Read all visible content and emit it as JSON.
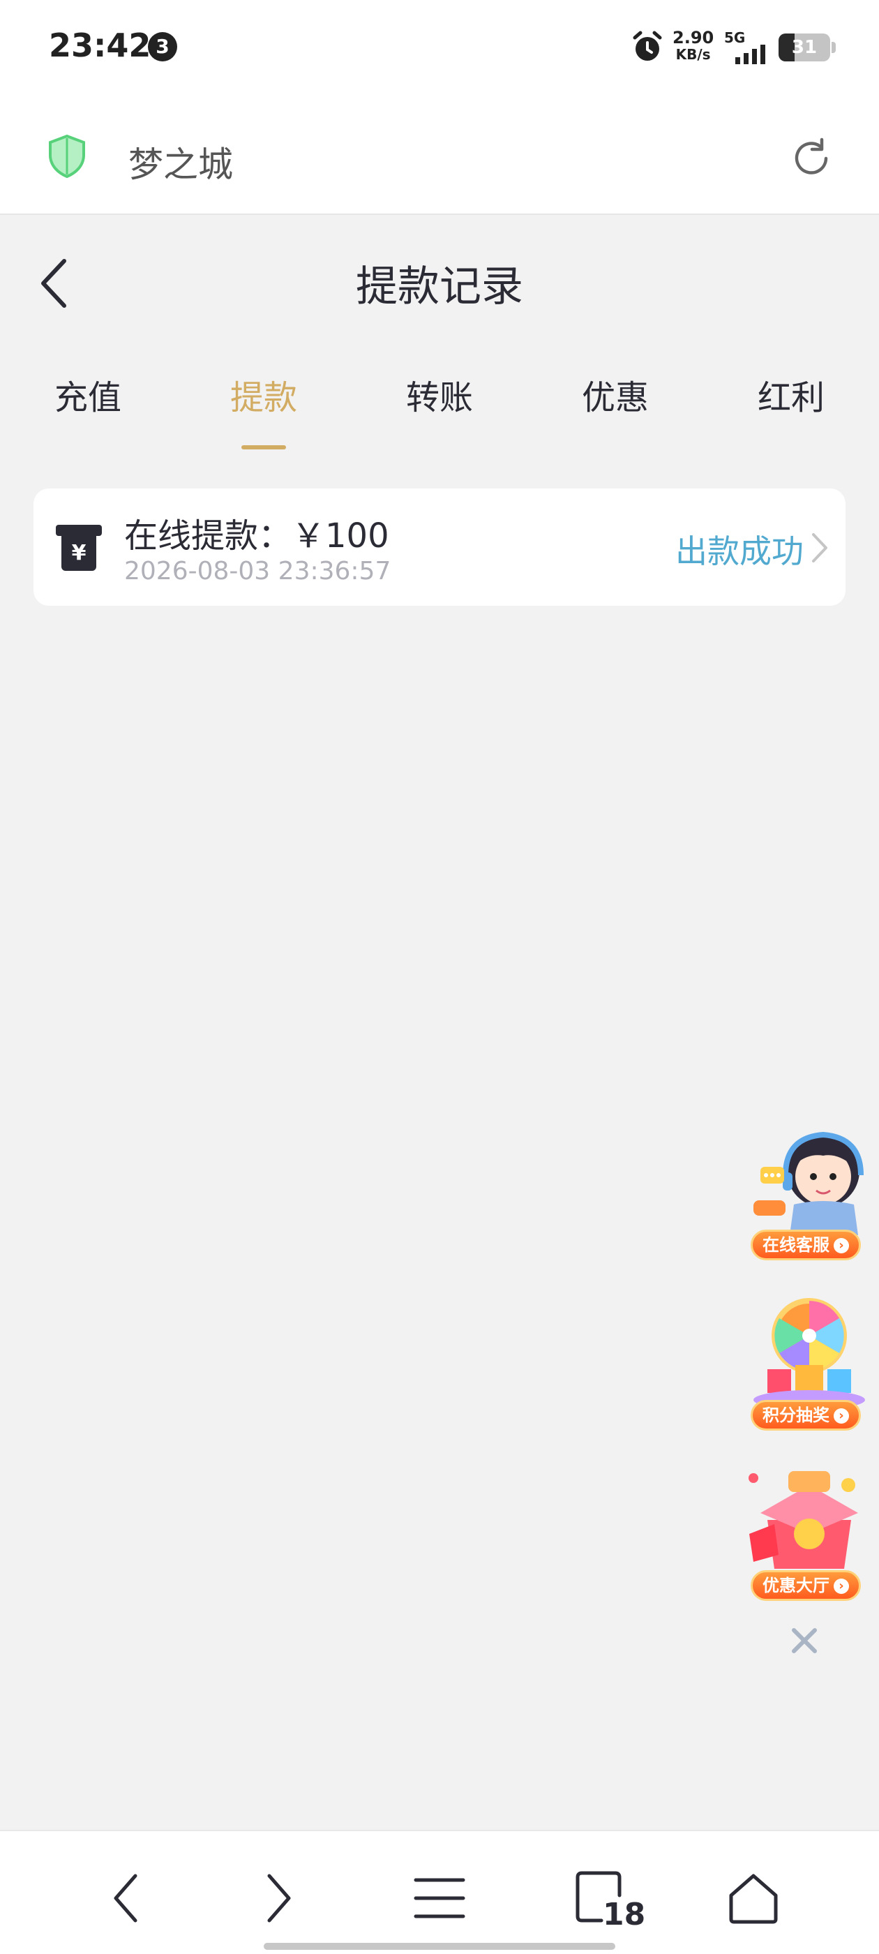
{
  "status_bar": {
    "time": "23:42",
    "notification_count": "3",
    "speed_value": "2.90",
    "speed_unit": "KB/s",
    "network": "5G",
    "battery": "31",
    "battery_level": 0.31
  },
  "browser": {
    "site_name": "梦之城",
    "tab_count": "18",
    "icons": [
      "shield-icon",
      "reload-icon",
      "back-arrow-icon",
      "forward-arrow-icon",
      "menu-icon",
      "tabs-icon",
      "home-icon"
    ]
  },
  "page": {
    "title": "提款记录",
    "tabs": [
      {
        "label": "充值",
        "active": false
      },
      {
        "label": "提款",
        "active": true
      },
      {
        "label": "转账",
        "active": false
      },
      {
        "label": "优惠",
        "active": false
      },
      {
        "label": "红利",
        "active": false
      }
    ],
    "records": [
      {
        "title": "在线提款：￥100",
        "date": "2026-08-03 23:36:57",
        "status": "出款成功"
      }
    ]
  },
  "floating": {
    "service": "在线客服",
    "lottery": "积分抽奖",
    "promo": "优惠大厅"
  },
  "colors": {
    "accent": "#d3ac63",
    "status_success": "#52a9cf",
    "background": "#f2f2f2"
  }
}
